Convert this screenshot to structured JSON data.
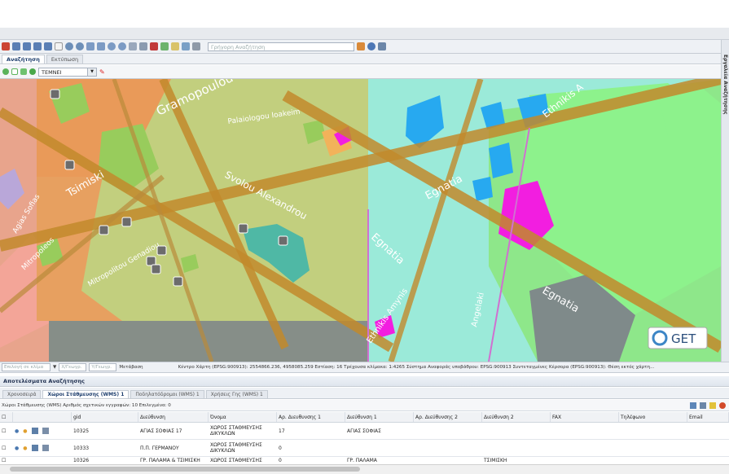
{
  "toolbar": {
    "quick_search_placeholder": "Γρήγορη Αναζήτηση"
  },
  "search_tabs": [
    "Αναζήτηση",
    "Εκτύπωση"
  ],
  "layer_select": {
    "value": "ΤΕΜΝΕΙ"
  },
  "sidebar": {
    "title": "Εργαλεία Αναζήτησης"
  },
  "map": {
    "streets": [
      "Gramopoulou",
      "Palaiologou Ioakeim",
      "Svolou Alexandrou",
      "Tsimiski",
      "Egnatia",
      "Agias Sofias",
      "Mitropoleos",
      "Mitropolitou Genadiou",
      "Egnatia",
      "Ethnikis Amynis",
      "Angelaki",
      "Egnatia",
      "Ethnikis A"
    ],
    "logo_text": "GET"
  },
  "statusbar": {
    "field1_placeholder": "Επιλογή σε κλίμα",
    "field2_placeholder": "Χ/Γεωγρ.",
    "field3_placeholder": "Υ/Γεωγρ.",
    "label_move": "Μετάβαση",
    "info": "Κέντρο Χάρτη (EPSG:900913): 2554866.236, 4958085.259 Εστίαση: 16  Τρέχουσα κλίμακα: 1:4265  Σύστημα Αναφοράς υποβάθρου: EPSG:900913  Συντεταγμένες Κέρσορα (EPSG:900913): Θέση εκτός χάρτη..."
  },
  "results": {
    "title": "Αποτελέσματα Αναζήτησης",
    "tabs": [
      "Χρονοσειρά",
      "Χώροι Στάθμευσης (WMS) 1",
      "Ποδηλατόδρομοι (WMS) 1",
      "Χρήσεις Γης (WMS) 1"
    ],
    "active_tab": 1,
    "info": "Χώροι Στάθμευσης (WMS)  Αριθμός σχετικών εγγραφών: 10  Επιλεγμένα: 0",
    "columns": [
      "gid",
      "Διεύθυνση",
      "Όνομα",
      "Αρ. Διευθυνσης 1",
      "Διεύθυνση 1",
      "Αρ. Διεύθυνσης 2",
      "Διεύθυνση 2",
      "FAX",
      "Τηλέφωνο",
      "Email"
    ],
    "rows": [
      [
        "10325",
        "ΑΓΙΑΣ ΣΟΦΙΑΣ 17",
        "ΧΩΡΟΣ ΣΤΑΘΜΕΥΣΗΣ ΔΙΚΥΚΛΩΝ",
        "17",
        "ΑΓΙΑΣ ΣΟΦΙΑΣ",
        "",
        "",
        "",
        "",
        ""
      ],
      [
        "10333",
        "Π.Π. ΓΕΡΜΑΝΟΥ",
        "ΧΩΡΟΣ ΣΤΑΘΜΕΥΣΗΣ ΔΙΚΥΚΛΩΝ",
        "0",
        "",
        "",
        "",
        "",
        "",
        ""
      ],
      [
        "10326",
        "ΓΡ. ΠΑΛΑΜΑ & ΤΣΙΜΙΣΚΗ",
        "ΧΩΡΟΣ ΣΤΑΘΜΕΥΣΗΣ",
        "0",
        "ΓΡ. ΠΑΛΑΜΑ",
        "",
        "ΤΣΙΜΙΣΚΗ",
        "",
        "",
        ""
      ]
    ]
  },
  "colors": {
    "landuse_orange": "#f0a86a",
    "landuse_green": "#c4d98a",
    "landuse_cyan": "#9ff0e0",
    "landuse_lightgreen": "#8ef28a",
    "landuse_blue": "#27a9f0",
    "landuse_magenta": "#f21ee0",
    "road": "#c7912f"
  }
}
